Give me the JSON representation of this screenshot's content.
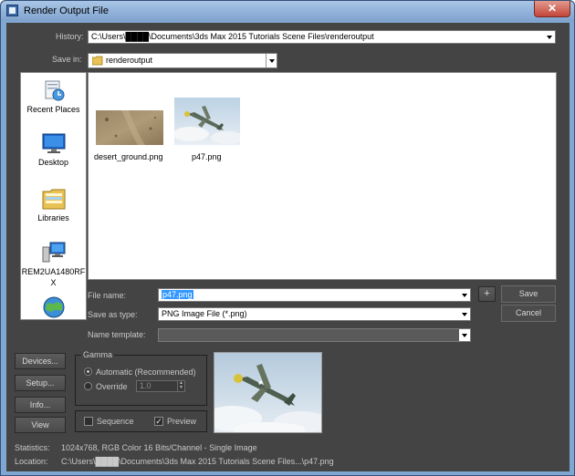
{
  "window": {
    "title": "Render Output File",
    "close_glyph": "✕"
  },
  "history": {
    "label": "History:",
    "value": "C:\\Users\\████\\Documents\\3ds Max 2015 Tutorials Scene Files\\renderoutput"
  },
  "save_in": {
    "label": "Save in:",
    "value": "renderoutput"
  },
  "places": [
    {
      "label": "Recent Places",
      "icon": "recent-places-icon"
    },
    {
      "label": "Desktop",
      "icon": "desktop-icon"
    },
    {
      "label": "Libraries",
      "icon": "libraries-icon"
    },
    {
      "label": "REM2UA1480RF X",
      "icon": "computer-icon"
    },
    {
      "label": "",
      "icon": "network-icon"
    }
  ],
  "files": [
    {
      "name": "desert_ground.png"
    },
    {
      "name": "p47.png"
    }
  ],
  "file_name": {
    "label": "File name:",
    "value": "p47.png"
  },
  "save_as_type": {
    "label": "Save as type:",
    "value": "PNG Image File (*.png)"
  },
  "name_template": {
    "label": "Name template:",
    "value": ""
  },
  "buttons": {
    "plus": "+",
    "save": "Save",
    "cancel": "Cancel",
    "devices": "Devices...",
    "setup": "Setup...",
    "info": "Info...",
    "view": "View"
  },
  "gamma": {
    "title": "Gamma",
    "automatic": "Automatic (Recommended)",
    "override": "Override",
    "override_value": "1.0"
  },
  "sequence": {
    "label": "Sequence",
    "checked": false
  },
  "preview": {
    "label": "Preview",
    "checked": true
  },
  "statistics": {
    "label": "Statistics:",
    "value": "1024x768, RGB Color 16 Bits/Channel - Single Image"
  },
  "location": {
    "label": "Location:",
    "value": "C:\\Users\\████\\Documents\\3ds Max 2015 Tutorials Scene Files...\\p47.png"
  },
  "colors": {
    "dialog_bg": "#444444",
    "title_bar": "#8fb1da",
    "selection": "#3399ff",
    "close_button": "#c4463a"
  }
}
